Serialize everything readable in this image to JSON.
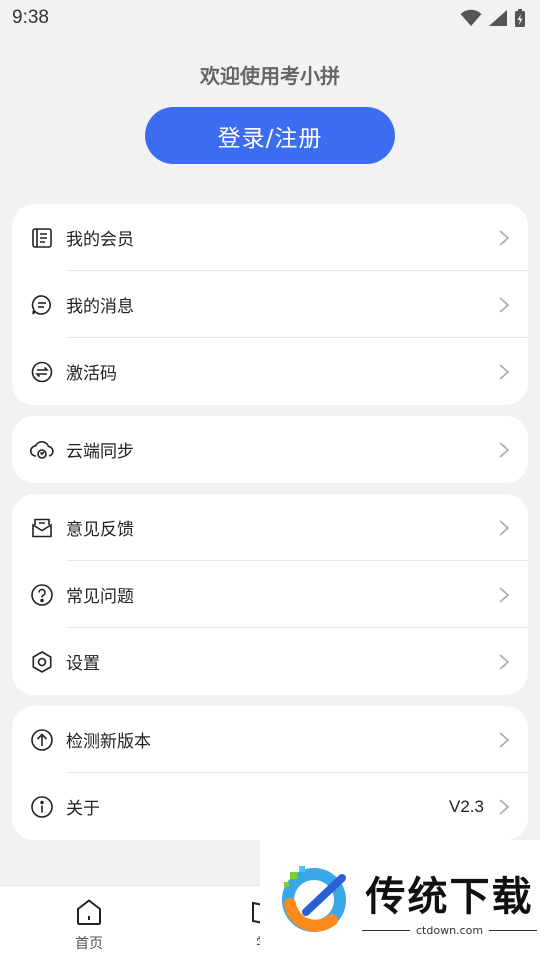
{
  "status_bar": {
    "time": "9:38"
  },
  "header": {
    "welcome": "欢迎使用考小拼",
    "login_label": "登录/注册"
  },
  "groups": [
    {
      "items": [
        {
          "label": "我的会员",
          "icon": "membership-card-icon"
        },
        {
          "label": "我的消息",
          "icon": "message-bubble-icon"
        },
        {
          "label": "激活码",
          "icon": "exchange-arrows-icon"
        }
      ]
    },
    {
      "items": [
        {
          "label": "云端同步",
          "icon": "cloud-sync-icon"
        }
      ]
    },
    {
      "items": [
        {
          "label": "意见反馈",
          "icon": "feedback-envelope-icon"
        },
        {
          "label": "常见问题",
          "icon": "question-circle-icon"
        },
        {
          "label": "设置",
          "icon": "settings-hexagon-icon"
        }
      ]
    },
    {
      "items": [
        {
          "label": "检测新版本",
          "icon": "upload-arrow-circle-icon"
        },
        {
          "label": "关于",
          "icon": "info-circle-icon",
          "value": "V2.3"
        }
      ]
    }
  ],
  "tabbar": {
    "home_label": "首页",
    "second_label": "学"
  },
  "watermark": {
    "title": "传统下载",
    "url": "ctdown.com"
  },
  "colors": {
    "accent": "#3c6df0",
    "background": "#f2f2f2"
  }
}
